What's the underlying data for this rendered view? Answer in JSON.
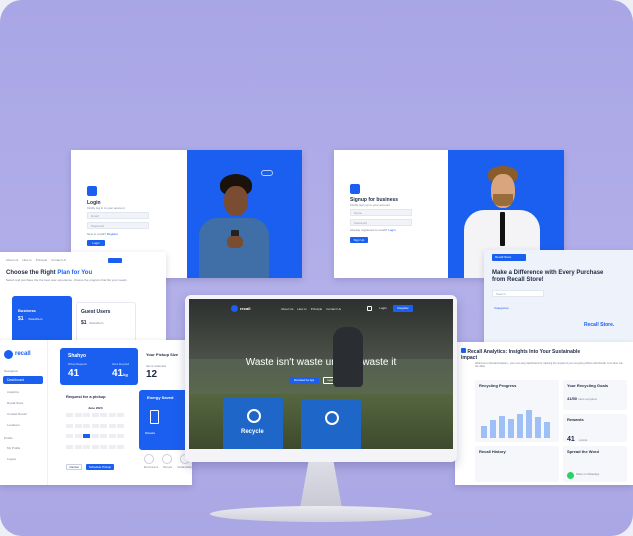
{
  "login": {
    "title": "Login",
    "subtitle": "Kindly log in to your account",
    "email_placeholder": "Email",
    "password_placeholder": "Password",
    "register_prompt": "New to recall?",
    "register_link": "Register",
    "button": "Login"
  },
  "signup": {
    "title": "Signup for business",
    "subtitle": "Kindly sign up to your account",
    "name_placeholder": "Name",
    "password_placeholder": "Password",
    "login_prompt": "Already registered to recall?",
    "login_link": "Login",
    "button": "Sign Up"
  },
  "pricing": {
    "nav": [
      "About Us",
      "How to",
      "Principle",
      "Contact Us"
    ],
    "heading_prefix": "Choose the Right",
    "heading_highlight": "Plan for You",
    "subheading": "Select and purchase the the best user experience, choose the program that fits your needs",
    "plans": [
      {
        "name": "Business",
        "price": "$1",
        "unit": "/Scan/Item"
      },
      {
        "name": "Guest Users",
        "price": "$1",
        "unit": "/Scan/Item"
      }
    ]
  },
  "dashboard": {
    "logo": "recall",
    "nav_section": "Navigation",
    "nav": [
      "Dashboard",
      "Analytics",
      "Recall Store",
      "Contact Recall",
      "Locations"
    ],
    "profile_section": "Profile",
    "profile_nav": [
      "My Profile",
      "Logout"
    ],
    "user_card": {
      "name": "Shahyo",
      "stat_a_label": "Pickup Requests",
      "stat_a": "41",
      "stat_b_label": "Items Recycled",
      "stat_b": "41",
      "stat_b_unit": "kg"
    },
    "pickup_size": {
      "title": "Your Pickup Size",
      "label": "Items collected",
      "value": "12"
    },
    "request_title": "Request for a pickup",
    "calendar_month": "June 2023",
    "energy": {
      "title": "Energy Saved",
      "label": "Kilowatts"
    },
    "icons": [
      "Environment",
      "Recycle",
      "Sustainability"
    ],
    "buttons": [
      "Cancel",
      "Schedule Pickup"
    ]
  },
  "monitor": {
    "logo": "recall",
    "nav": [
      "About Us",
      "How to",
      "Principle",
      "Contact Us"
    ],
    "login": "Login",
    "register": "Register",
    "headline": "Waste isn't waste until we waste it",
    "cta_primary": "Download the App",
    "cta_secondary": "Learn More",
    "bin_label": "Recycle"
  },
  "store": {
    "badge": "Recall Store",
    "heading": "Make a Difference with Every Purchase from Recall Store!",
    "search_placeholder": "Search",
    "categories": "Categories",
    "watermark": "Recall Store."
  },
  "analytics": {
    "title_prefix": "Recall Analytics: Insights Into Your",
    "title_suffix": "Sustainable Impact",
    "welcome": "Welcome to Recall Analytics - your one-stop dashboard for tracking the impact of your recycling efforts with Recall. Let's dive into the data!",
    "progress_title": "Recycling Progress",
    "goals_title": "Your Recycling Goals",
    "goals_value": "41/50",
    "goals_unit": "cans recycled",
    "rewards_title": "Rewards",
    "rewards_value": "41",
    "rewards_unit": "points",
    "history_title": "Recall History",
    "spread_title": "Spread the Word",
    "whatsapp": "Share on WhatsApp"
  },
  "colors": {
    "brand": "#1a5ff0",
    "background": "#aaa7e6"
  }
}
